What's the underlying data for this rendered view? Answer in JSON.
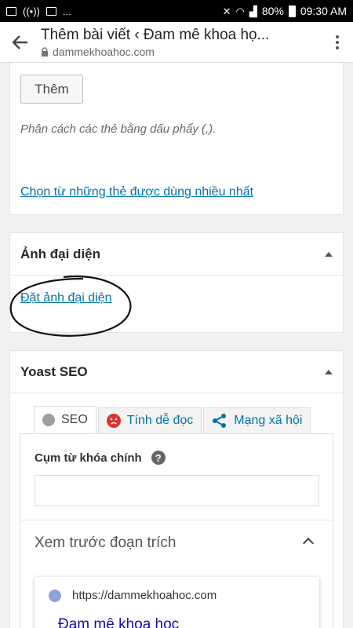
{
  "status_bar": {
    "left_dots": "...",
    "battery": "80%",
    "time": "09:30 AM"
  },
  "browser": {
    "title": "Thêm bài viết ‹ Đam mê khoa họ...",
    "url": "dammekhoahoc.com"
  },
  "tags_panel": {
    "add_button": "Thêm",
    "hint": "Phân cách các thẻ bằng dấu phẩy (,).",
    "choose_link": "Chọn từ những thẻ được dùng nhiều nhất"
  },
  "featured_image": {
    "title": "Ảnh đại diện",
    "set_link": "Đặt ảnh đại diện"
  },
  "yoast": {
    "title": "Yoast SEO",
    "tabs": [
      {
        "label": "SEO",
        "icon": "grey-dot-icon"
      },
      {
        "label": "Tính dễ đọc",
        "icon": "sad-face-icon"
      },
      {
        "label": "Mạng xã hội",
        "icon": "share-icon"
      }
    ],
    "keyphrase_label": "Cụm từ khóa chính",
    "keyphrase_value": "",
    "preview_title": "Xem trước đoạn trích",
    "snippet_url": "https://dammekhoahoc.com",
    "snippet_title": "Đam mê khoa học"
  },
  "colors": {
    "link": "#0073aa",
    "readability_bad": "#dc3232"
  }
}
